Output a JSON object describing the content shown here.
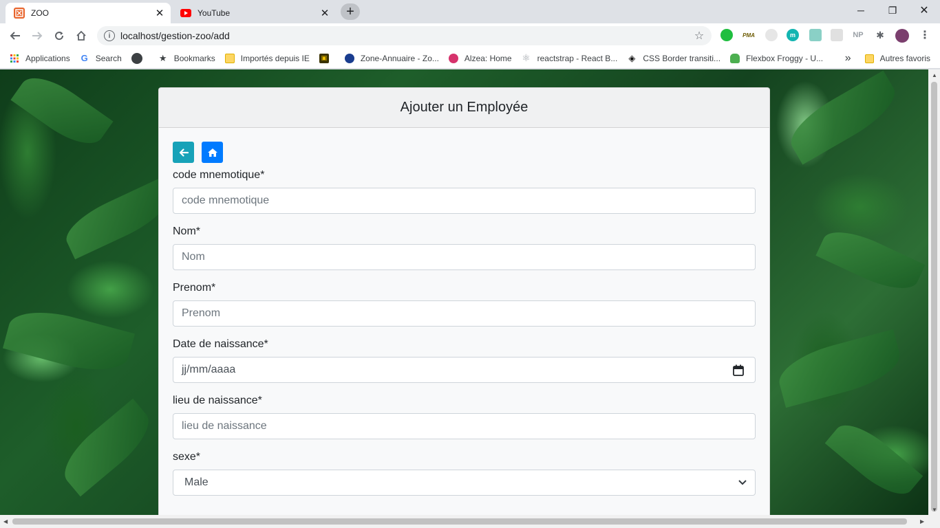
{
  "browser": {
    "tabs": [
      {
        "title": "ZOO",
        "active": true,
        "favicon": "zoo-favicon"
      },
      {
        "title": "YouTube",
        "active": false,
        "favicon": "youtube-favicon"
      }
    ],
    "new_tab": "+",
    "url": "localhost/gestion-zoo/add",
    "extensions": [
      "PMA",
      "NP"
    ],
    "bookmarks": [
      {
        "label": "Applications",
        "icon": "apps-grid-icon"
      },
      {
        "label": "Search",
        "icon": "google-icon"
      },
      {
        "label": "",
        "icon": "circle-icon"
      },
      {
        "label": "Bookmarks",
        "icon": "star-icon"
      },
      {
        "label": "Importés depuis IE",
        "icon": "folder-icon"
      },
      {
        "label": "",
        "icon": "site-icon"
      },
      {
        "label": "Zone-Annuaire - Zo...",
        "icon": "globe-icon"
      },
      {
        "label": "Alzea: Home",
        "icon": "alzea-icon"
      },
      {
        "label": "reactstrap - React B...",
        "icon": "react-icon"
      },
      {
        "label": "CSS Border transiti...",
        "icon": "codepen-icon"
      },
      {
        "label": "Flexbox Froggy - U...",
        "icon": "frog-icon"
      }
    ],
    "bookmarks_overflow": "»",
    "other_bookmarks": "Autres favoris"
  },
  "form": {
    "title": "Ajouter un Employée",
    "fields": [
      {
        "label": "code mnemotique*",
        "placeholder": "code mnemotique"
      },
      {
        "label": "Nom*",
        "placeholder": "Nom"
      },
      {
        "label": "Prenom*",
        "placeholder": "Prenom"
      },
      {
        "label": "Date de naissance*",
        "placeholder": "jj/mm/aaaa"
      },
      {
        "label": "lieu de naissance*",
        "placeholder": "lieu de naissance"
      },
      {
        "label": "sexe*",
        "value": "Male"
      }
    ]
  },
  "colors": {
    "back_button": "#17a2b8",
    "home_button": "#007bff"
  }
}
